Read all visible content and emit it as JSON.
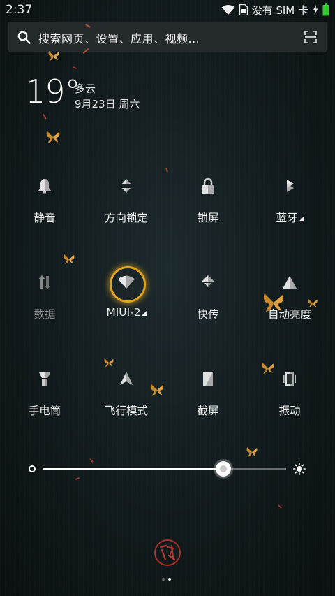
{
  "status_bar": {
    "time": "2:37",
    "carrier": "没有 SIM 卡",
    "icons": [
      "wifi-icon",
      "sim-icon",
      "charging-icon",
      "battery-icon"
    ],
    "battery_color": "#33cc33"
  },
  "search": {
    "placeholder": "搜索网页、设置、应用、视频...",
    "icons": [
      "search-icon",
      "scan-icon"
    ]
  },
  "weather": {
    "temperature": "19°",
    "condition": "多云",
    "date": "9月23日 周六"
  },
  "toggles": [
    {
      "label": "静音",
      "icon": "bell-icon",
      "active": false
    },
    {
      "label": "方向锁定",
      "icon": "rotation-lock-icon",
      "active": false
    },
    {
      "label": "锁屏",
      "icon": "lock-icon",
      "active": false
    },
    {
      "label": "蓝牙",
      "icon": "bluetooth-icon",
      "active": false,
      "expandable": true
    },
    {
      "label": "数据",
      "icon": "mobile-data-icon",
      "active": false,
      "disabled": true
    },
    {
      "label": "MIUI-2",
      "icon": "wifi-icon",
      "active": true,
      "expandable": true
    },
    {
      "label": "快传",
      "icon": "quick-transfer-icon",
      "active": false
    },
    {
      "label": "自动亮度",
      "icon": "auto-brightness-icon",
      "active": false
    },
    {
      "label": "手电筒",
      "icon": "flashlight-icon",
      "active": false
    },
    {
      "label": "飞行模式",
      "icon": "airplane-icon",
      "active": false
    },
    {
      "label": "截屏",
      "icon": "screenshot-icon",
      "active": false
    },
    {
      "label": "振动",
      "icon": "vibrate-icon",
      "active": false
    }
  ],
  "brightness": {
    "level": 0.74
  },
  "pager": {
    "pages": 2,
    "current": 2
  },
  "accent_color": "#e2a522"
}
